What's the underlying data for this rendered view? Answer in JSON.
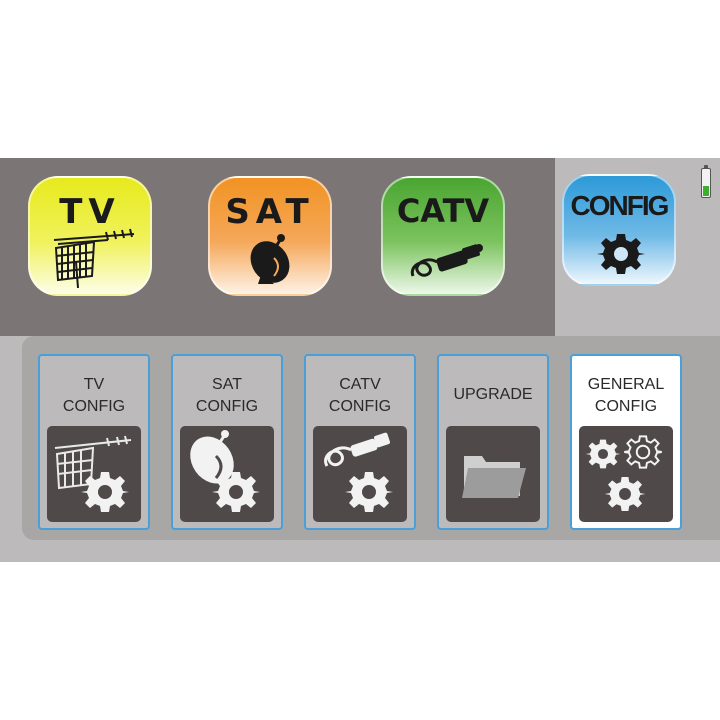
{
  "modes": [
    {
      "label": "TV",
      "icon": "antenna-icon"
    },
    {
      "label": "SAT",
      "icon": "satellite-dish-icon"
    },
    {
      "label": "CATV",
      "icon": "coax-cable-icon"
    },
    {
      "label": "CONFIG",
      "icon": "gear-icon"
    }
  ],
  "selected_mode": "CONFIG",
  "battery": {
    "level": 0.35,
    "color": "#3fae2f"
  },
  "submenu": [
    {
      "label": "TV\nCONFIG",
      "icon": "antenna-gear-icon"
    },
    {
      "label": "SAT\nCONFIG",
      "icon": "dish-gear-icon"
    },
    {
      "label": "CATV\nCONFIG",
      "icon": "cable-gear-icon"
    },
    {
      "label": "UPGRADE",
      "icon": "folder-icon"
    },
    {
      "label": "GENERAL\nCONFIG",
      "icon": "gears-icon"
    }
  ],
  "selected_submenu": "GENERAL\nCONFIG",
  "colors": {
    "tv": "#e7ea1c",
    "sat": "#f19323",
    "catv": "#4aa531",
    "config": "#2d9ad8",
    "tile_border": "#4a9fd9",
    "panel": "#7b7575"
  }
}
